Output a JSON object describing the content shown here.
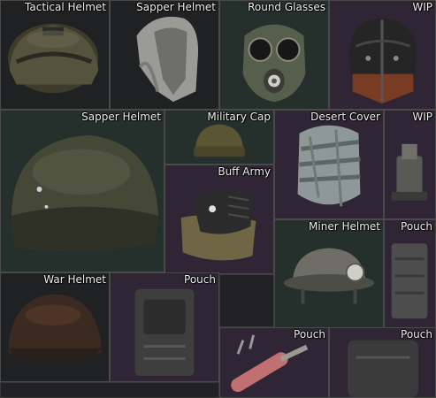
{
  "inventory": {
    "items": [
      {
        "label": "Tactical Helmet",
        "icon": "tactical-helmet-icon"
      },
      {
        "label": "Sapper Helmet",
        "icon": "sapper-hood-icon"
      },
      {
        "label": "Round Glasses",
        "icon": "gas-mask-icon"
      },
      {
        "label": "WIP",
        "icon": "wip-helmet-icon"
      },
      {
        "label": "Sapper Helmet",
        "icon": "sapper-helmet-icon"
      },
      {
        "label": "Military Cap",
        "icon": "military-cap-icon"
      },
      {
        "label": "Desert Cover",
        "icon": "desert-cover-icon"
      },
      {
        "label": "WIP",
        "icon": "wip-item-icon"
      },
      {
        "label": "Buff Army",
        "icon": "buff-mask-icon"
      },
      {
        "label": "Miner Helmet",
        "icon": "miner-helmet-icon"
      },
      {
        "label": "Pouch",
        "icon": "pouch-icon"
      },
      {
        "label": "War Helmet",
        "icon": "war-helmet-icon"
      },
      {
        "label": "Pouch",
        "icon": "pouch-icon"
      },
      {
        "label": "Pouch",
        "icon": "gas-canister-icon"
      },
      {
        "label": "Pouch",
        "icon": "pouch-icon"
      }
    ],
    "colors": {
      "tile_green": "#25302c",
      "tile_purple": "#2f2535",
      "tile_dark": "#202122",
      "tile_border": "#4a4a4a",
      "label_text": "#eeeeee"
    }
  }
}
